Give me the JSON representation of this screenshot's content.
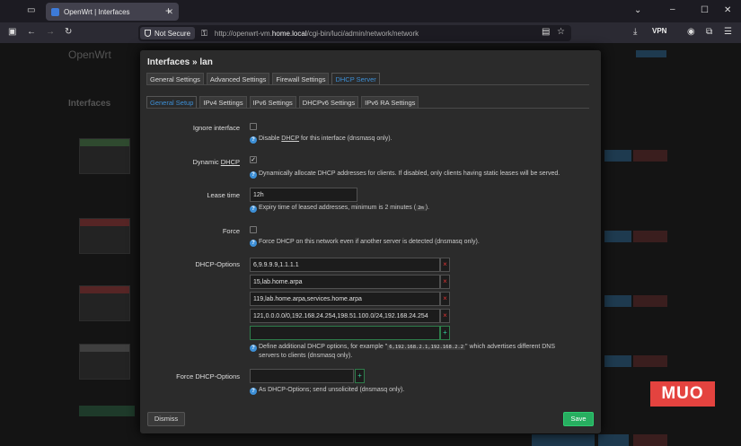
{
  "browser": {
    "tab_title": "OpenWrt | Interfaces",
    "security_label": "Not Secure",
    "url_prefix": "http://openwrt-vm.",
    "url_host": "home.local",
    "url_path": "/cgi-bin/luci/admin/network/network",
    "vpn_label": "VPN"
  },
  "background": {
    "brand": "OpenWrt",
    "section": "Interfaces"
  },
  "modal": {
    "title": "Interfaces » lan",
    "tabs": [
      "General Settings",
      "Advanced Settings",
      "Firewall Settings",
      "DHCP Server"
    ],
    "subtabs": [
      "General Setup",
      "IPv4 Settings",
      "IPv6 Settings",
      "DHCPv6 Settings",
      "IPv6 RA Settings"
    ],
    "ignore_interface": {
      "label": "Ignore interface",
      "checked": false,
      "help_pre": "Disable ",
      "help_abbr": "DHCP",
      "help_post": " for this interface (dnsmasq only)."
    },
    "dynamic_dhcp": {
      "label_pre": "Dynamic ",
      "label_abbr": "DHCP",
      "checked": true,
      "help": "Dynamically allocate DHCP addresses for clients. If disabled, only clients having static leases will be served."
    },
    "lease_time": {
      "label": "Lease time",
      "value": "12h",
      "help_pre": "Expiry time of leased addresses, minimum is 2 minutes (",
      "help_code": "2m",
      "help_post": ")."
    },
    "force": {
      "label": "Force",
      "checked": false,
      "help": "Force DHCP on this network even if another server is detected (dnsmasq only)."
    },
    "dhcp_options": {
      "label": "DHCP-Options",
      "values": [
        "6,9.9.9.9,1.1.1.1",
        "15,lab.home.arpa",
        "119,lab.home.arpa,services.home.arpa",
        "121,0.0.0.0/0,192.168.24.254,198.51.100.0/24,192.168.24.254"
      ],
      "new_value": "",
      "help_line1_pre": "Define additional DHCP options, for example \"",
      "help_code": "6,192.168.2.1,192.168.2.2",
      "help_line1_post": "\" which advertises different DNS",
      "help_line2": "servers to clients (dnsmasq only)."
    },
    "force_dhcp_options": {
      "label": "Force DHCP-Options",
      "value": "",
      "help": "As DHCP-Options; send unsolicited (dnsmasq only)."
    },
    "dismiss_label": "Dismiss",
    "save_label": "Save"
  },
  "watermark": "MUO",
  "colors": {
    "accent": "#3d8fd6",
    "save": "#27ae60",
    "remove": "#dd3333",
    "watermark": "#e4433f"
  }
}
